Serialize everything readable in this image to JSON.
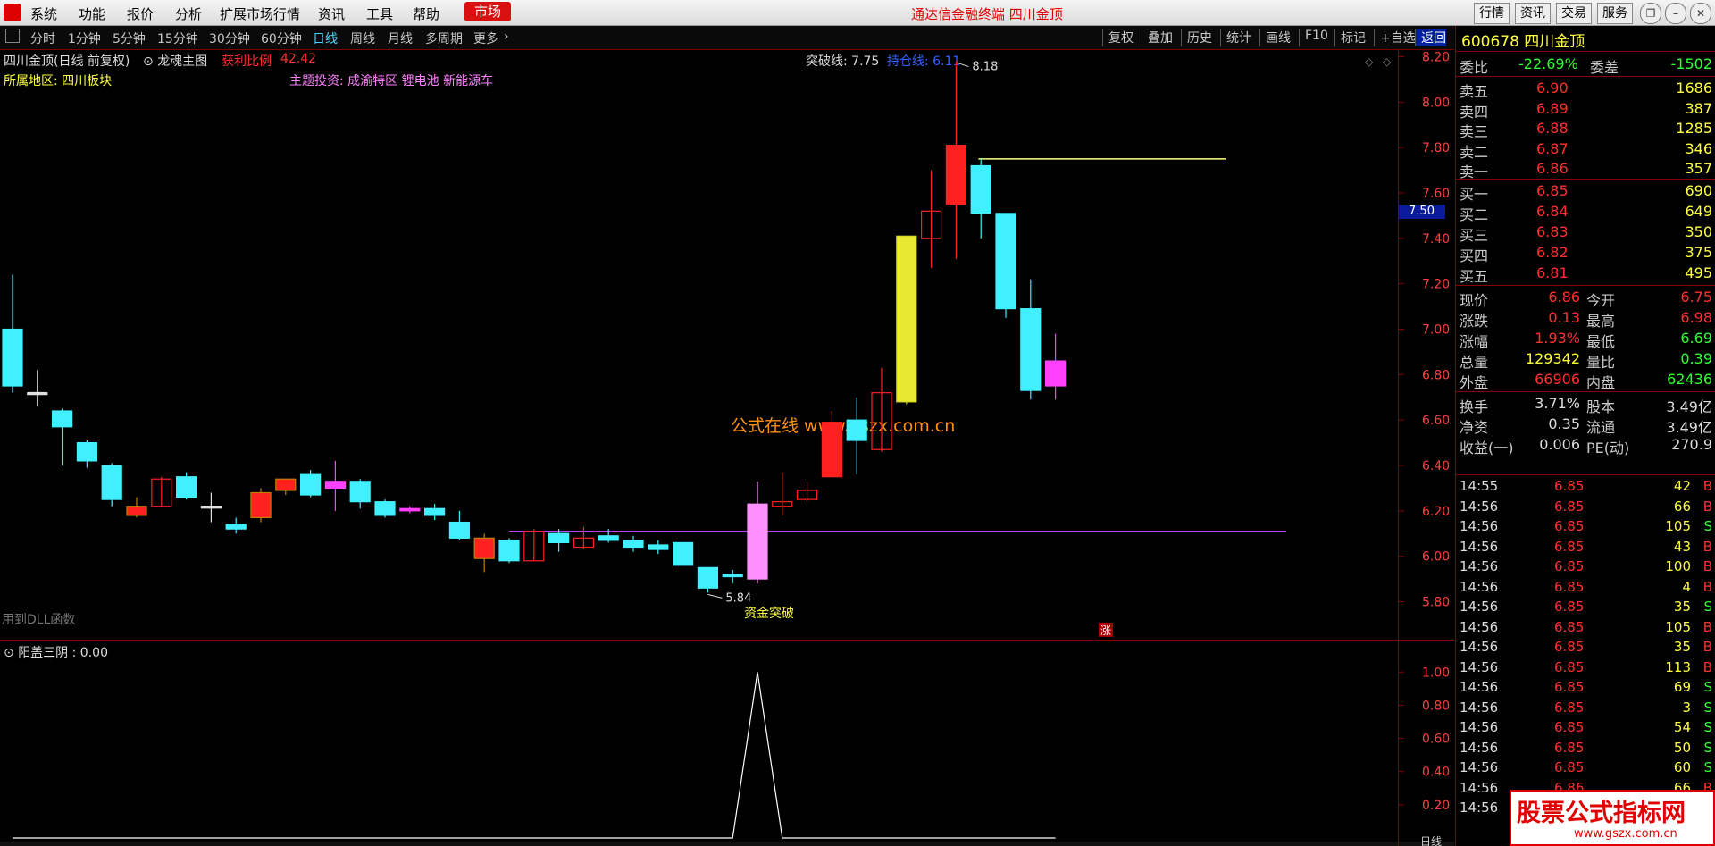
{
  "menu": {
    "items": [
      "系统",
      "功能",
      "报价",
      "分析",
      "扩展市场行情",
      "资讯",
      "工具",
      "帮助"
    ],
    "market_label": "市场",
    "app_title": "通达信金融终端  四川金顶",
    "right_buttons": [
      "行情",
      "资讯",
      "交易",
      "服务"
    ]
  },
  "periods": {
    "items": [
      "分时",
      "1分钟",
      "5分钟",
      "15分钟",
      "30分钟",
      "60分钟",
      "日线",
      "周线",
      "月线",
      "多周期",
      "更多"
    ],
    "active": "日线",
    "tools": [
      "复权",
      "叠加",
      "历史",
      "统计",
      "画线",
      "F10",
      "标记",
      "+自选",
      "返回"
    ]
  },
  "chart": {
    "title": "四川金顶(日线 前复权)",
    "indicator_name": "龙魂主图",
    "profit_label": "获利比例",
    "profit_value": "42.42",
    "breakout_line": "突破线: 7.75",
    "support_line": "持仓线: 6.11",
    "region_label": "所属地区: 四川板块",
    "theme_label": "主题投资: 成渝特区 锂电池 新能源车",
    "dll_label": "用到DLL函数",
    "watermark": "公式在线  www.gszx.com.cn",
    "signal_label": "资金突破",
    "high_mark": "8.18",
    "low_mark": "5.84",
    "rise_marker": "涨",
    "current_price_tag": "7.50",
    "y_ticks": [
      "8.20",
      "8.00",
      "7.80",
      "7.60",
      "7.40",
      "7.20",
      "7.00",
      "6.80",
      "6.60",
      "6.40",
      "6.20",
      "6.00",
      "5.80"
    ],
    "sub_title": "阳盖三阴 : 0.00",
    "sub_ticks": [
      "1.00",
      "0.80",
      "0.60",
      "0.40",
      "0.20"
    ],
    "bottom_label": "日线"
  },
  "chart_data": {
    "type": "candlestick",
    "candles": [
      {
        "o": 6.75,
        "c": 7.0,
        "h": 7.24,
        "l": 6.72,
        "kind": "down"
      },
      {
        "o": 6.72,
        "c": 6.72,
        "h": 6.82,
        "l": 6.66,
        "kind": "cross"
      },
      {
        "o": 6.64,
        "c": 6.57,
        "h": 6.65,
        "l": 6.4,
        "kind": "down"
      },
      {
        "o": 6.5,
        "c": 6.42,
        "h": 6.51,
        "l": 6.39,
        "kind": "down"
      },
      {
        "o": 6.4,
        "c": 6.25,
        "h": 6.41,
        "l": 6.22,
        "kind": "down"
      },
      {
        "o": 6.22,
        "c": 6.18,
        "h": 6.26,
        "l": 6.17,
        "kind": "mix"
      },
      {
        "o": 6.22,
        "c": 6.34,
        "h": 6.35,
        "l": 6.22,
        "kind": "upline"
      },
      {
        "o": 6.35,
        "c": 6.26,
        "h": 6.37,
        "l": 6.25,
        "kind": "down"
      },
      {
        "o": 6.22,
        "c": 6.22,
        "h": 6.28,
        "l": 6.15,
        "kind": "cross"
      },
      {
        "o": 6.14,
        "c": 6.12,
        "h": 6.17,
        "l": 6.1,
        "kind": "down"
      },
      {
        "o": 6.17,
        "c": 6.28,
        "h": 6.3,
        "l": 6.15,
        "kind": "mix"
      },
      {
        "o": 6.29,
        "c": 6.34,
        "h": 6.34,
        "l": 6.27,
        "kind": "mix"
      },
      {
        "o": 6.36,
        "c": 6.27,
        "h": 6.38,
        "l": 6.26,
        "kind": "down"
      },
      {
        "o": 6.33,
        "c": 6.3,
        "h": 6.42,
        "l": 6.2,
        "kind": "magenta"
      },
      {
        "o": 6.33,
        "c": 6.24,
        "h": 6.34,
        "l": 6.21,
        "kind": "down"
      },
      {
        "o": 6.24,
        "c": 6.18,
        "h": 6.25,
        "l": 6.17,
        "kind": "down"
      },
      {
        "o": 6.21,
        "c": 6.2,
        "h": 6.22,
        "l": 6.19,
        "kind": "magenta"
      },
      {
        "o": 6.21,
        "c": 6.18,
        "h": 6.23,
        "l": 6.16,
        "kind": "down"
      },
      {
        "o": 6.15,
        "c": 6.08,
        "h": 6.2,
        "l": 6.07,
        "kind": "down"
      },
      {
        "o": 6.08,
        "c": 5.99,
        "h": 6.1,
        "l": 5.93,
        "kind": "mix"
      },
      {
        "o": 6.07,
        "c": 5.98,
        "h": 6.08,
        "l": 5.97,
        "kind": "down"
      },
      {
        "o": 5.98,
        "c": 6.11,
        "h": 6.12,
        "l": 5.98,
        "kind": "upline"
      },
      {
        "o": 6.1,
        "c": 6.06,
        "h": 6.12,
        "l": 6.02,
        "kind": "down"
      },
      {
        "o": 6.04,
        "c": 6.08,
        "h": 6.13,
        "l": 6.03,
        "kind": "upline"
      },
      {
        "o": 6.09,
        "c": 6.07,
        "h": 6.12,
        "l": 6.06,
        "kind": "down"
      },
      {
        "o": 6.07,
        "c": 6.04,
        "h": 6.09,
        "l": 6.02,
        "kind": "down"
      },
      {
        "o": 6.05,
        "c": 6.03,
        "h": 6.07,
        "l": 6.01,
        "kind": "down"
      },
      {
        "o": 6.06,
        "c": 5.96,
        "h": 6.06,
        "l": 5.96,
        "kind": "down"
      },
      {
        "o": 5.95,
        "c": 5.86,
        "h": 5.95,
        "l": 5.84,
        "kind": "down"
      },
      {
        "o": 5.92,
        "c": 5.91,
        "h": 5.94,
        "l": 5.88,
        "kind": "down"
      },
      {
        "o": 5.9,
        "c": 6.23,
        "h": 6.33,
        "l": 5.88,
        "kind": "pinkbig"
      },
      {
        "o": 6.22,
        "c": 6.24,
        "h": 6.37,
        "l": 6.18,
        "kind": "upline"
      },
      {
        "o": 6.25,
        "c": 6.29,
        "h": 6.33,
        "l": 6.24,
        "kind": "upline"
      },
      {
        "o": 6.35,
        "c": 6.59,
        "h": 6.64,
        "l": 6.35,
        "kind": "red"
      },
      {
        "o": 6.6,
        "c": 6.51,
        "h": 6.7,
        "l": 6.36,
        "kind": "down"
      },
      {
        "o": 6.47,
        "c": 6.72,
        "h": 6.83,
        "l": 6.46,
        "kind": "upline"
      },
      {
        "o": 6.68,
        "c": 7.41,
        "h": 7.41,
        "l": 6.67,
        "kind": "yellow"
      },
      {
        "o": 7.4,
        "c": 7.52,
        "h": 7.7,
        "l": 7.27,
        "kind": "upline"
      },
      {
        "o": 7.55,
        "c": 7.81,
        "h": 8.18,
        "l": 7.31,
        "kind": "red"
      },
      {
        "o": 7.72,
        "c": 7.51,
        "h": 7.75,
        "l": 7.4,
        "kind": "down"
      },
      {
        "o": 7.51,
        "c": 7.09,
        "h": 7.51,
        "l": 7.05,
        "kind": "down"
      },
      {
        "o": 7.09,
        "c": 6.73,
        "h": 7.22,
        "l": 6.69,
        "kind": "down"
      },
      {
        "o": 6.75,
        "c": 6.86,
        "h": 6.98,
        "l": 6.69,
        "kind": "magenta"
      }
    ],
    "support_line": {
      "value": 6.11
    },
    "resistance_line": {
      "value": 7.75
    },
    "sub_series": {
      "name": "阳盖三阴",
      "values": [
        0,
        0,
        0,
        0,
        0,
        0,
        0,
        0,
        0,
        0,
        0,
        0,
        0,
        0,
        0,
        0,
        0,
        0,
        0,
        0,
        0,
        0,
        0,
        0,
        0,
        0,
        0,
        0,
        0,
        0,
        1,
        0,
        0,
        0,
        0,
        0,
        0,
        0,
        0,
        0,
        0,
        0,
        0
      ]
    },
    "ylim": [
      5.7,
      8.25
    ]
  },
  "quote": {
    "code_name": "600678 四川金顶",
    "weibi_label": "委比",
    "weibi": "-22.69%",
    "weicha_label": "委差",
    "weicha": "-1502",
    "asks": [
      {
        "label": "卖五",
        "price": "6.90",
        "vol": "1686"
      },
      {
        "label": "卖四",
        "price": "6.89",
        "vol": "387"
      },
      {
        "label": "卖三",
        "price": "6.88",
        "vol": "1285"
      },
      {
        "label": "卖二",
        "price": "6.87",
        "vol": "346"
      },
      {
        "label": "卖一",
        "price": "6.86",
        "vol": "357"
      }
    ],
    "bids": [
      {
        "label": "买一",
        "price": "6.85",
        "vol": "690"
      },
      {
        "label": "买二",
        "price": "6.84",
        "vol": "649"
      },
      {
        "label": "买三",
        "price": "6.83",
        "vol": "350"
      },
      {
        "label": "买四",
        "price": "6.82",
        "vol": "375"
      },
      {
        "label": "买五",
        "price": "6.81",
        "vol": "495"
      }
    ],
    "stats1": [
      {
        "l1": "现价",
        "v1": "6.86",
        "c1": "#ff3030",
        "l2": "今开",
        "v2": "6.75",
        "c2": "#ff3030"
      },
      {
        "l1": "涨跌",
        "v1": "0.13",
        "c1": "#ff3030",
        "l2": "最高",
        "v2": "6.98",
        "c2": "#ff3030"
      },
      {
        "l1": "涨幅",
        "v1": "1.93%",
        "c1": "#ff3030",
        "l2": "最低",
        "v2": "6.69",
        "c2": "#30ff30"
      },
      {
        "l1": "总量",
        "v1": "129342",
        "c1": "#ffff30",
        "l2": "量比",
        "v2": "0.39",
        "c2": "#30ff30"
      },
      {
        "l1": "外盘",
        "v1": "66906",
        "c1": "#ff3030",
        "l2": "内盘",
        "v2": "62436",
        "c2": "#30ff30"
      }
    ],
    "stats2": [
      {
        "l1": "换手",
        "v1": "3.71%",
        "l2": "股本",
        "v2": "3.49亿"
      },
      {
        "l1": "净资",
        "v1": "0.35",
        "l2": "流通",
        "v2": "3.49亿"
      },
      {
        "l1": "收益(一)",
        "v1": "0.006",
        "l2": "PE(动)",
        "v2": "270.9"
      }
    ],
    "ticks": [
      {
        "t": "14:55",
        "p": "6.85",
        "v": "42",
        "s": "B"
      },
      {
        "t": "14:56",
        "p": "6.85",
        "v": "66",
        "s": "B"
      },
      {
        "t": "14:56",
        "p": "6.85",
        "v": "105",
        "s": "S"
      },
      {
        "t": "14:56",
        "p": "6.85",
        "v": "43",
        "s": "B"
      },
      {
        "t": "14:56",
        "p": "6.85",
        "v": "100",
        "s": "B"
      },
      {
        "t": "14:56",
        "p": "6.85",
        "v": "4",
        "s": "B"
      },
      {
        "t": "14:56",
        "p": "6.85",
        "v": "35",
        "s": "S"
      },
      {
        "t": "14:56",
        "p": "6.85",
        "v": "105",
        "s": "B"
      },
      {
        "t": "14:56",
        "p": "6.85",
        "v": "35",
        "s": "B"
      },
      {
        "t": "14:56",
        "p": "6.85",
        "v": "113",
        "s": "B"
      },
      {
        "t": "14:56",
        "p": "6.85",
        "v": "69",
        "s": "S"
      },
      {
        "t": "14:56",
        "p": "6.85",
        "v": "3",
        "s": "S"
      },
      {
        "t": "14:56",
        "p": "6.85",
        "v": "54",
        "s": "S"
      },
      {
        "t": "14:56",
        "p": "6.85",
        "v": "50",
        "s": "S"
      },
      {
        "t": "14:56",
        "p": "6.85",
        "v": "60",
        "s": "S"
      },
      {
        "t": "14:56",
        "p": "6.86",
        "v": "66",
        "s": "B"
      },
      {
        "t": "14:56",
        "p": "",
        "v": "",
        "s": ""
      }
    ]
  },
  "ad": {
    "line1": "股票公式指标网",
    "line2": "www.gszx.com.cn"
  },
  "colors": {
    "up": "#ff2020",
    "down": "#40f0ff",
    "accent": "#d81010",
    "support": "#c040ff",
    "resistance": "#ffff80"
  }
}
